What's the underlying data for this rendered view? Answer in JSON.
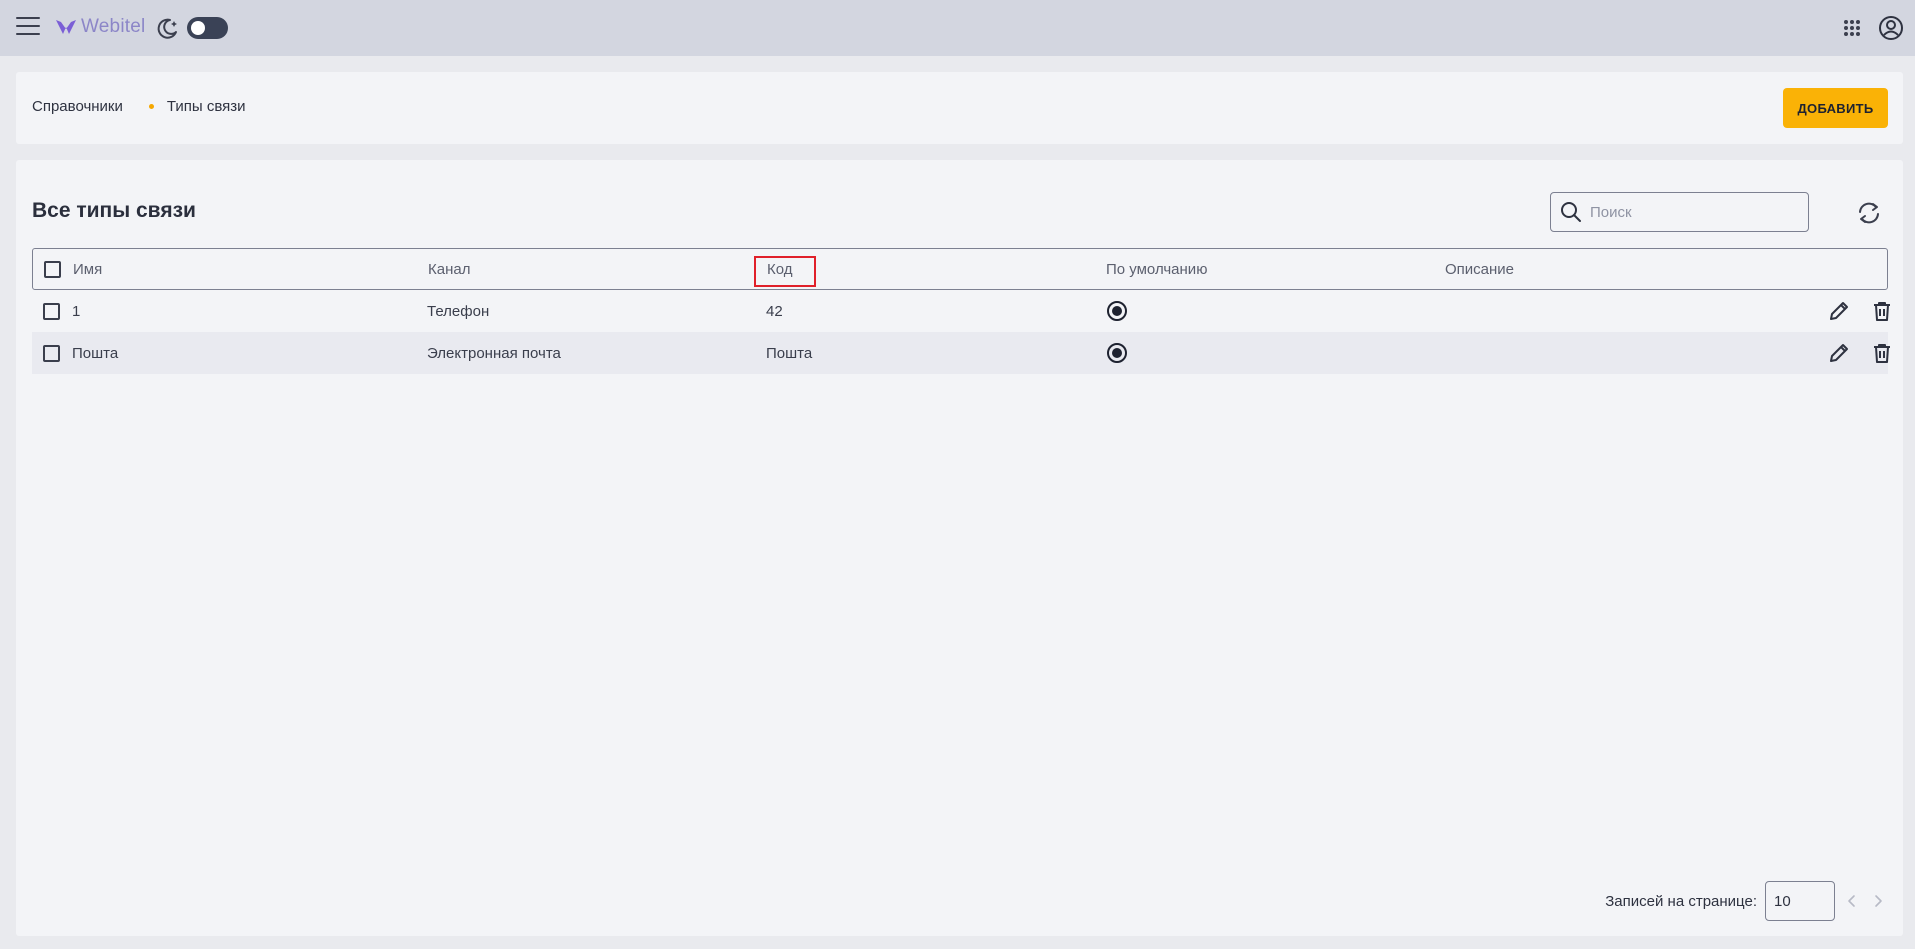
{
  "topbar": {
    "logo_text": "Webitel",
    "icons": [
      "hamburger-icon",
      "moon-icon",
      "apps-grid-icon",
      "account-icon"
    ],
    "dark_mode": false
  },
  "breadcrumb": {
    "items": [
      "Справочники",
      "Типы связи"
    ]
  },
  "header": {
    "add_label": "ДОБАВИТЬ"
  },
  "main": {
    "title": "Все типы связи",
    "search_placeholder": "Поиск"
  },
  "table": {
    "columns": [
      "Имя",
      "Канал",
      "Код",
      "По умолчанию",
      "Описание"
    ],
    "rows": [
      {
        "name": "1",
        "channel": "Телефон",
        "code": "42",
        "default": true,
        "description": ""
      },
      {
        "name": "Пошта",
        "channel": "Электронная почта",
        "code": "Пошта",
        "default": true,
        "description": ""
      }
    ]
  },
  "pagination": {
    "label": "Записей на странице:",
    "per_page": "10"
  },
  "colors": {
    "accent": "#fab206",
    "topbar": "#d3d6e0",
    "highlight": "#e0202a"
  }
}
